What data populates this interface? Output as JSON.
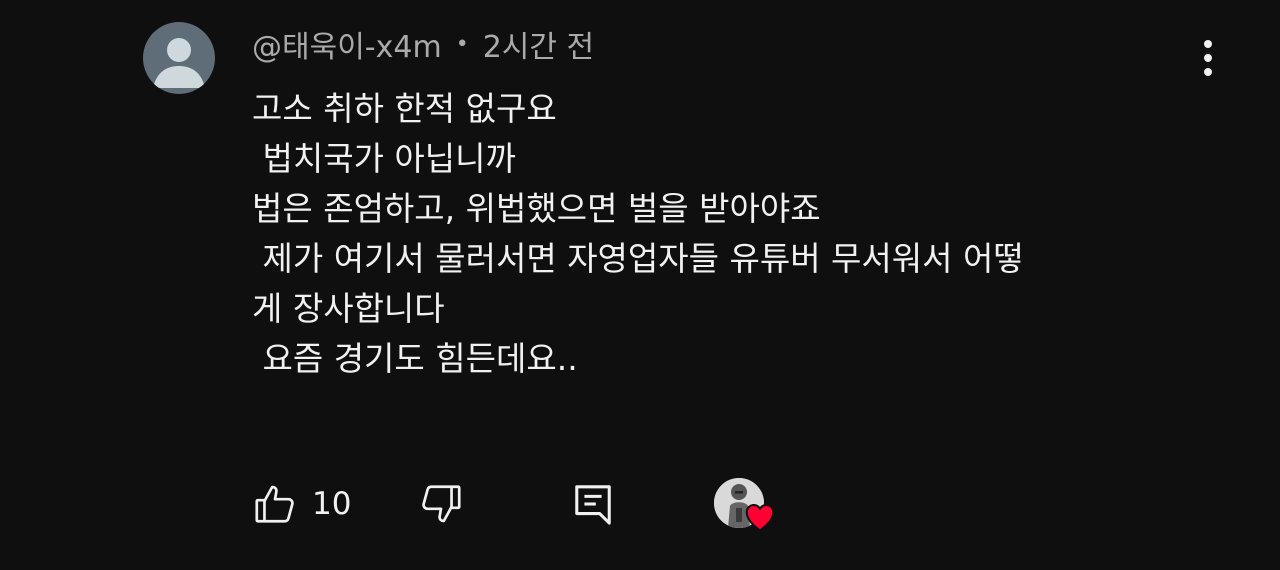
{
  "comment": {
    "author": "@태욱이-x4m",
    "separator": "•",
    "time": "2시간 전",
    "lines": [
      "고소 취하 한적 없구요",
      " 법치국가 아닙니까",
      "법은 존엄하고, 위법했으면 벌을 받아야죠",
      " 제가 여기서 물러서면 자영업자들 유튜버 무서워서 어떻",
      "게 장사합니다",
      " 요즘 경기도 힘든데요.."
    ],
    "like_count": "10"
  },
  "icons": {
    "avatar": "default-avatar-icon",
    "more": "more-vertical-icon",
    "like": "thumb-up-icon",
    "dislike": "thumb-down-icon",
    "reply": "reply-icon",
    "heart": "heart-icon"
  },
  "colors": {
    "background": "#0f0f0f",
    "text": "#f1f1f1",
    "meta": "#aaaaaa",
    "heart": "#ff0033",
    "avatar": "#5f6d78"
  }
}
